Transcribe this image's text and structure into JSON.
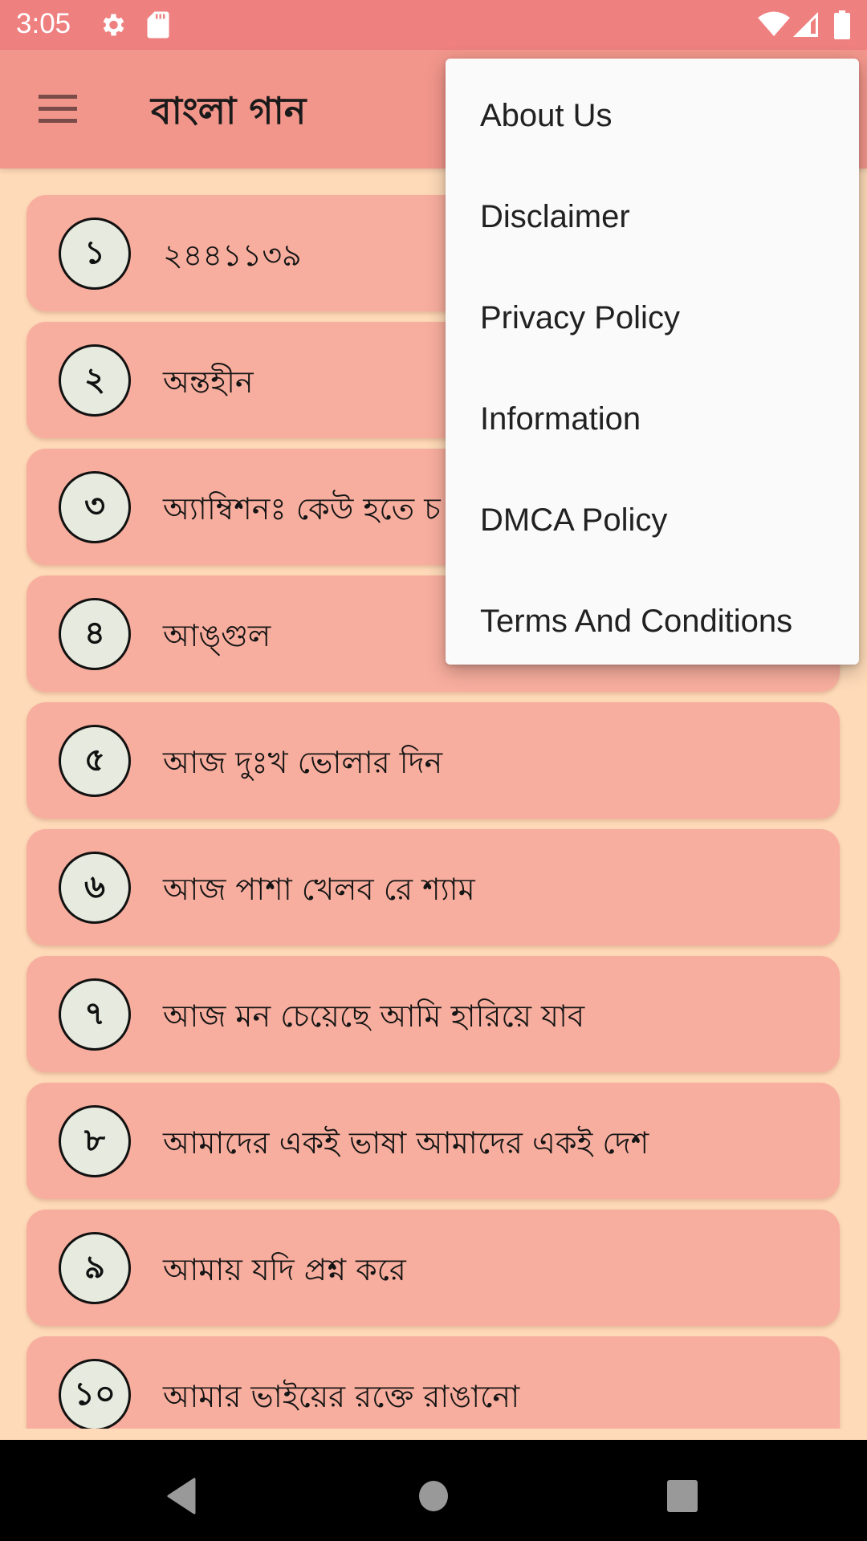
{
  "status_bar": {
    "time": "3:05",
    "icons": [
      "settings-icon",
      "sd-card-icon",
      "wifi-icon",
      "signal-icon",
      "battery-icon"
    ]
  },
  "toolbar": {
    "menu_icon": "hamburger-menu-icon",
    "title": "বাংলা গান"
  },
  "songs": [
    {
      "number": "১",
      "title": "২৪৪১১৩৯"
    },
    {
      "number": "২",
      "title": "অন্তহীন"
    },
    {
      "number": "৩",
      "title": "অ্যাম্বিশনঃ কেউ হতে চ"
    },
    {
      "number": "৪",
      "title": "আঙ্গুল"
    },
    {
      "number": "৫",
      "title": "আজ দুঃখ ভোলার দিন"
    },
    {
      "number": "৬",
      "title": "আজ পাশা খেলব রে শ্যাম"
    },
    {
      "number": "৭",
      "title": "আজ মন চেয়েছে আমি হারিয়ে যাব"
    },
    {
      "number": "৮",
      "title": "আমাদের একই ভাষা আমাদের একই দেশ"
    },
    {
      "number": "৯",
      "title": "আমায় যদি প্রশ্ন করে"
    },
    {
      "number": "১০",
      "title": "আমার ভাইয়ের রক্তে রাঙানো"
    }
  ],
  "overflow_menu": {
    "items": [
      {
        "label": "About Us"
      },
      {
        "label": "Disclaimer"
      },
      {
        "label": "Privacy Policy"
      },
      {
        "label": "Information"
      },
      {
        "label": "DMCA Policy"
      },
      {
        "label": "Terms And Conditions"
      }
    ]
  },
  "nav_bar": {
    "back": "back-icon",
    "home": "home-icon",
    "recents": "recents-icon"
  },
  "colors": {
    "status_bar": "#EF8080",
    "toolbar": "#F2968B",
    "background": "#FEDAB8",
    "card": "#F8AE9E",
    "number_circle": "#E6EADF",
    "menu_bg": "#FAFAFA"
  }
}
